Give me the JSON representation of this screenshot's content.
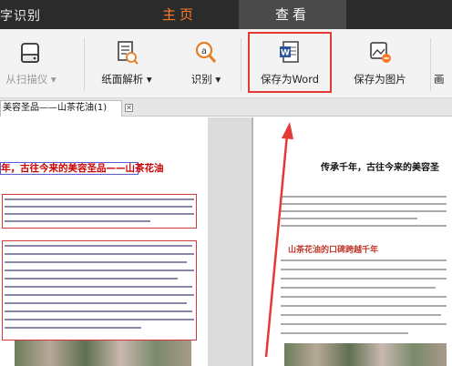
{
  "app": {
    "title_fragment": "字识别"
  },
  "tabs": [
    {
      "label": "主页",
      "active": true
    },
    {
      "label": "查看",
      "active": false
    }
  ],
  "ribbon": {
    "scan_label": "从扫描仪 ▾",
    "page_parse_label": "纸面解析 ▾",
    "recognize_label": "识别 ▾",
    "save_word_label": "保存为Word",
    "save_image_label": "保存为图片",
    "last_fragment": "画"
  },
  "doc_tab": {
    "label": "美容圣品——山茶花油(1)",
    "close": "✕"
  },
  "left_doc": {
    "heading": "年，古往今来的美容圣品——山茶花油"
  },
  "right_doc": {
    "title": "传承千年，古往今来的美容圣",
    "subtitle": "山茶花油的口碑跨越千年"
  },
  "colors": {
    "accent_orange": "#ff7a2a",
    "highlight_red": "#e53935",
    "word_blue": "#2b579a"
  },
  "icons": [
    "scanner-icon",
    "page-parse-icon",
    "recognize-icon",
    "word-icon",
    "image-save-icon"
  ]
}
